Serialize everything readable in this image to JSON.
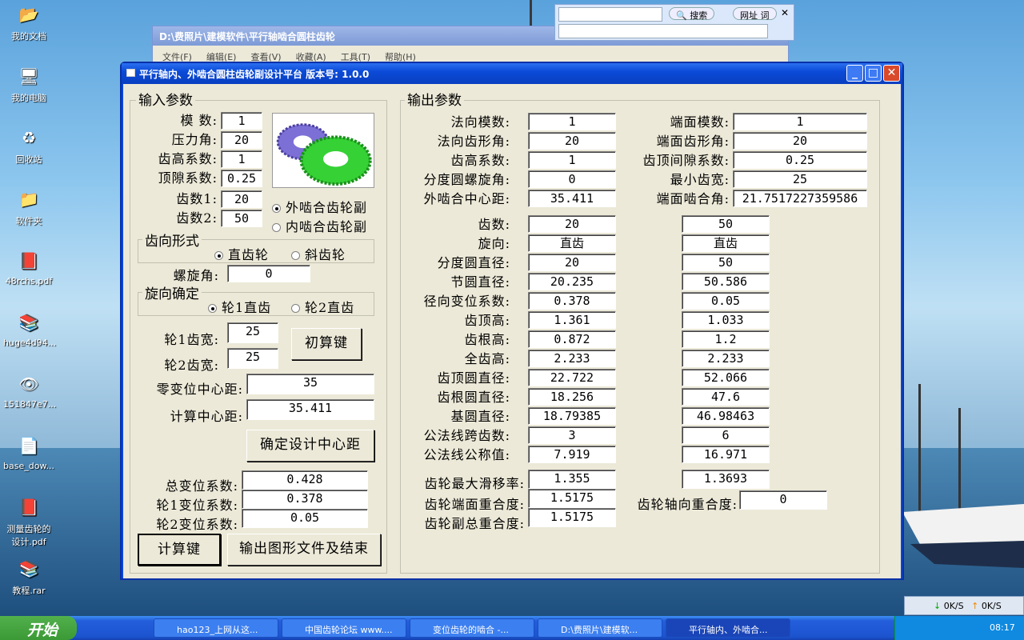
{
  "desktop": {
    "icons": [
      {
        "label": "我的文档",
        "icon": "folder-docs-icon"
      },
      {
        "label": "我的电脑",
        "icon": "computer-icon"
      },
      {
        "label": "回收站",
        "icon": "recycle-bin-icon"
      },
      {
        "label": "软件夹",
        "icon": "folder-icon"
      },
      {
        "label": "48rchs.pdf",
        "icon": "pdf-icon"
      },
      {
        "label": "huge4d94...",
        "icon": "rar-icon"
      },
      {
        "label": "151847e7...",
        "icon": "image-icon"
      },
      {
        "label": "base_dow...",
        "icon": "file-icon"
      },
      {
        "label": "测量齿轮的设计.pdf",
        "icon": "pdf-icon"
      },
      {
        "label": "教程.rar",
        "icon": "rar-icon"
      }
    ]
  },
  "explorer": {
    "title": "D:\\费照片\\建模软件\\平行轴啮合圆柱齿轮",
    "menu": [
      "文件(F)",
      "编辑(E)",
      "查看(V)",
      "收藏(A)",
      "工具(T)",
      "帮助(H)"
    ]
  },
  "searchbar": {
    "search": "搜索",
    "url": "网址 词"
  },
  "window": {
    "title": "平行轴内、外啮合圆柱齿轮副设计平台 版本号: 1.0.0",
    "input": {
      "group_label": "输入参数",
      "module_label": "模  数:",
      "module": "1",
      "pressure_label": "压力角:",
      "pressure": "20",
      "addendum_label": "齿高系数:",
      "addendum": "1",
      "clearance_label": "顶隙系数:",
      "clearance": "0.25",
      "z1_label": "齿数1:",
      "z1": "20",
      "z2_label": "齿数2:",
      "z2": "50",
      "mesh_external": "外啮合齿轮副",
      "mesh_internal": "内啮合齿轮副",
      "tooth_form_label": "齿向形式",
      "spur": "直齿轮",
      "helical": "斜齿轮",
      "helix_label": "螺旋角:",
      "helix": "0",
      "direction_label": "旋向确定",
      "dir1": "轮1直齿",
      "dir2": "轮2直齿",
      "w1_label": "轮1齿宽:",
      "w1": "25",
      "w2_label": "轮2齿宽:",
      "w2": "25",
      "initcalc": "初算键",
      "zero_cd_label": "零变位中心距:",
      "zero_cd": "35",
      "calc_cd_label": "计算中心距:",
      "calc_cd": "35.411",
      "confirm_cd": "确定设计中心距",
      "total_x_label": "总变位系数:",
      "total_x": "0.428",
      "x1_label": "轮1变位系数:",
      "x1": "0.378",
      "x2_label": "轮2变位系数:",
      "x2": "0.05",
      "calc_btn": "计算键",
      "output_btn": "输出图形文件及结束"
    },
    "output": {
      "group_label": "输出参数",
      "top_left": [
        {
          "label": "法向模数:",
          "value": "1"
        },
        {
          "label": "法向齿形角:",
          "value": "20"
        },
        {
          "label": "齿高系数:",
          "value": "1"
        },
        {
          "label": "分度圆螺旋角:",
          "value": "0"
        },
        {
          "label": "外啮合中心距:",
          "value": "35.411"
        }
      ],
      "top_right": [
        {
          "label": "端面模数:",
          "value": "1"
        },
        {
          "label": "端面齿形角:",
          "value": "20"
        },
        {
          "label": "齿顶间隙系数:",
          "value": "0.25"
        },
        {
          "label": "最小齿宽:",
          "value": "25"
        },
        {
          "label": "端面啮合角:",
          "value": "21.7517227359586"
        }
      ],
      "gear_rows": [
        {
          "label": "齿数:",
          "g1": "20",
          "g2": "50"
        },
        {
          "label": "旋向:",
          "g1": "直齿",
          "g2": "直齿"
        },
        {
          "label": "分度圆直径:",
          "g1": "20",
          "g2": "50"
        },
        {
          "label": "节圆直径:",
          "g1": "20.235",
          "g2": "50.586"
        },
        {
          "label": "径向变位系数:",
          "g1": "0.378",
          "g2": "0.05"
        },
        {
          "label": "齿顶高:",
          "g1": "1.361",
          "g2": "1.033"
        },
        {
          "label": "齿根高:",
          "g1": "0.872",
          "g2": "1.2"
        },
        {
          "label": "全齿高:",
          "g1": "2.233",
          "g2": "2.233"
        },
        {
          "label": "齿顶圆直径:",
          "g1": "22.722",
          "g2": "52.066"
        },
        {
          "label": "齿根圆直径:",
          "g1": "18.256",
          "g2": "47.6"
        },
        {
          "label": "基圆直径:",
          "g1": "18.79385",
          "g2": "46.98463"
        },
        {
          "label": "公法线跨齿数:",
          "g1": "3",
          "g2": "6"
        },
        {
          "label": "公法线公称值:",
          "g1": "7.919",
          "g2": "16.971"
        }
      ],
      "slip_label": "齿轮最大滑移率:",
      "slip1": "1.355",
      "slip2": "1.3693",
      "transverse_label": "齿轮端面重合度:",
      "transverse": "1.5175",
      "axial_label": "齿轮轴向重合度:",
      "axial": "0",
      "total_label": "齿轮副总重合度:",
      "total": "1.5175"
    }
  },
  "netbar": {
    "down": "0K/S",
    "up": "0K/S"
  },
  "taskbar": {
    "start": "开始",
    "items": [
      "hao123_上网从这...",
      "中国齿轮论坛 www....",
      "变位齿轮的啮合 -...",
      "D:\\费照片\\建模软...",
      "平行轴内、外啮合..."
    ],
    "clock": "08:17"
  }
}
